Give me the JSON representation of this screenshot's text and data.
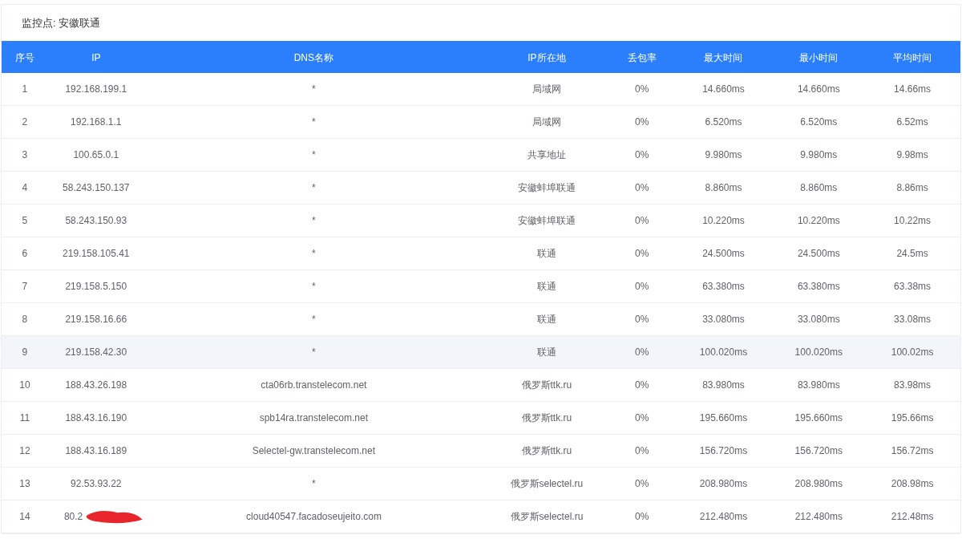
{
  "title": "监控点: 安徽联通",
  "table": {
    "columns": [
      "序号",
      "IP",
      "DNS名称",
      "IP所在地",
      "丢包率",
      "最大时间",
      "最小时间",
      "平均时间"
    ],
    "rows": [
      {
        "cells": [
          "1",
          "192.168.199.1",
          "*",
          "局域网",
          "0%",
          "14.660ms",
          "14.660ms",
          "14.66ms"
        ],
        "selected": false,
        "redacted": false
      },
      {
        "cells": [
          "2",
          "192.168.1.1",
          "*",
          "局域网",
          "0%",
          "6.520ms",
          "6.520ms",
          "6.52ms"
        ],
        "selected": false,
        "redacted": false
      },
      {
        "cells": [
          "3",
          "100.65.0.1",
          "*",
          "共享地址",
          "0%",
          "9.980ms",
          "9.980ms",
          "9.98ms"
        ],
        "selected": false,
        "redacted": false
      },
      {
        "cells": [
          "4",
          "58.243.150.137",
          "*",
          "安徽蚌埠联通",
          "0%",
          "8.860ms",
          "8.860ms",
          "8.86ms"
        ],
        "selected": false,
        "redacted": false
      },
      {
        "cells": [
          "5",
          "58.243.150.93",
          "*",
          "安徽蚌埠联通",
          "0%",
          "10.220ms",
          "10.220ms",
          "10.22ms"
        ],
        "selected": false,
        "redacted": false
      },
      {
        "cells": [
          "6",
          "219.158.105.41",
          "*",
          "联通",
          "0%",
          "24.500ms",
          "24.500ms",
          "24.5ms"
        ],
        "selected": false,
        "redacted": false
      },
      {
        "cells": [
          "7",
          "219.158.5.150",
          "*",
          "联通",
          "0%",
          "63.380ms",
          "63.380ms",
          "63.38ms"
        ],
        "selected": false,
        "redacted": false
      },
      {
        "cells": [
          "8",
          "219.158.16.66",
          "*",
          "联通",
          "0%",
          "33.080ms",
          "33.080ms",
          "33.08ms"
        ],
        "selected": false,
        "redacted": false
      },
      {
        "cells": [
          "9",
          "219.158.42.30",
          "*",
          "联通",
          "0%",
          "100.020ms",
          "100.020ms",
          "100.02ms"
        ],
        "selected": true,
        "redacted": false
      },
      {
        "cells": [
          "10",
          "188.43.26.198",
          "cta06rb.transtelecom.net",
          "俄罗斯ttk.ru",
          "0%",
          "83.980ms",
          "83.980ms",
          "83.98ms"
        ],
        "selected": false,
        "redacted": false
      },
      {
        "cells": [
          "11",
          "188.43.16.190",
          "spb14ra.transtelecom.net",
          "俄罗斯ttk.ru",
          "0%",
          "195.660ms",
          "195.660ms",
          "195.66ms"
        ],
        "selected": false,
        "redacted": false
      },
      {
        "cells": [
          "12",
          "188.43.16.189",
          "Selectel-gw.transtelecom.net",
          "俄罗斯ttk.ru",
          "0%",
          "156.720ms",
          "156.720ms",
          "156.72ms"
        ],
        "selected": false,
        "redacted": false
      },
      {
        "cells": [
          "13",
          "92.53.93.22",
          "*",
          "俄罗斯selectel.ru",
          "0%",
          "208.980ms",
          "208.980ms",
          "208.98ms"
        ],
        "selected": false,
        "redacted": false
      },
      {
        "cells": [
          "14",
          "80.2",
          "cloud40547.facadoseujeito.com",
          "俄罗斯selectel.ru",
          "0%",
          "212.480ms",
          "212.480ms",
          "212.48ms"
        ],
        "selected": false,
        "redacted": true
      }
    ]
  }
}
